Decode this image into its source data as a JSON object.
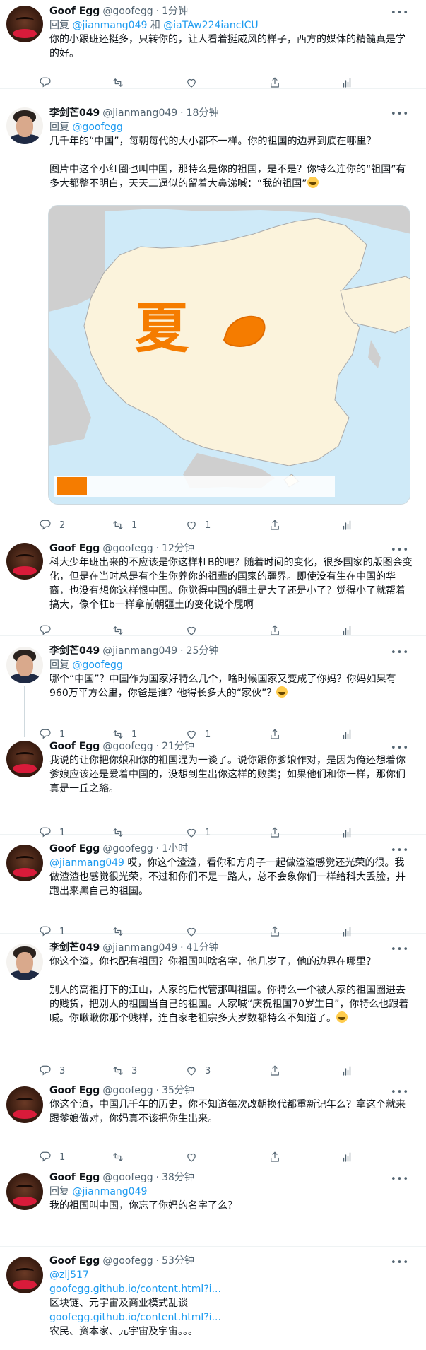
{
  "tweets": [
    {
      "name": "Goof Egg",
      "handle": "@goofegg",
      "time": "1分钟",
      "reply_prefix": "回复",
      "reply_to": "@jianmang049",
      "reply_joiner": "和",
      "reply_to_2": "@iaTAw224iancICU",
      "text": [
        "你的小跟班还挺多，只转你的，让人看着挺威风的样子，西方的媒体的精髓真是学的好。"
      ],
      "stats": {
        "reply": "",
        "retweet": "",
        "like": ""
      }
    },
    {
      "name": "李剑芒049",
      "handle": "@jianmang049",
      "time": "18分钟",
      "reply_prefix": "回复",
      "reply_to": "@goofegg",
      "text_1": "几千年的“中国”，每朝每代的大小都不一样。你的祖国的边界到底在哪里？",
      "text_2": "图片中这个小红圈也叫中国，那特么是你的祖国，是不是？你特么连你的“祖国”有多大都整不明白，天天二逼似的留着大鼻涕喊：“我的祖国”",
      "map_label": "夏",
      "stats": {
        "reply": "2",
        "retweet": "1",
        "like": "1"
      }
    },
    {
      "name": "Goof Egg",
      "handle": "@goofegg",
      "time": "12分钟",
      "text": [
        "科大少年班出来的不应该是你这样杠B的吧？随着时间的变化，很多国家的版图会变化，但是在当时总是有个生你养你的祖辈的国家的疆界。即使没有生在中国的华裔，也没有想你这样恨中国。你觉得中国的疆土是大了还是小了？觉得小了就帮着搞大，像个杠b一样拿前朝疆土的变化说个屁啊"
      ],
      "stats": {
        "reply": "",
        "retweet": "",
        "like": ""
      }
    },
    {
      "name": "李剑芒049",
      "handle": "@jianmang049",
      "time": "25分钟",
      "reply_prefix": "回复",
      "reply_to": "@goofegg",
      "text": [
        "哪个“中国”？中国作为国家好特么几个，啥时候国家又变成了你妈？你妈如果有960万平方公里，你爸是谁？他得长多大的“家伙”？"
      ],
      "stats": {
        "reply": "1",
        "retweet": "1",
        "like": "1"
      }
    },
    {
      "name": "Goof Egg",
      "handle": "@goofegg",
      "time": "21分钟",
      "text": [
        "我说的让你把你娘和你的祖国混为一谈了。说你跟你爹娘作对，是因为俺还想着你爹娘应该还是爱着中国的，没想到生出你这样的败类；如果他们和你一样，那你们真是一丘之貉。"
      ],
      "stats": {
        "reply": "1",
        "retweet": "",
        "like": "1"
      }
    },
    {
      "name": "Goof Egg",
      "handle": "@goofegg",
      "time": "1小时",
      "mention": "@jianmang049",
      "text_after_mention": "哎，你这个渣渣，看你和方舟子一起做渣渣感觉还光荣的很。我做渣渣也感觉很光荣，不过和你们不是一路人，总不会象你们一样给科大丢脸，并跑出来黑自己的祖国。",
      "stats": {
        "reply": "1",
        "retweet": "",
        "like": ""
      }
    },
    {
      "name": "李剑芒049",
      "handle": "@jianmang049",
      "time": "41分钟",
      "text_1": "你这个渣，你也配有祖国？你祖国叫啥名字，他几岁了，他的边界在哪里？",
      "text_2": "别人的高祖打下的江山，人家的后代管那叫祖国。你特么一个被人家的祖国圈进去的贱货，把别人的祖国当自己的祖国。人家喊“庆祝祖国70岁生日”，你特么也跟着喊。你瞅瞅你那个贱样，连自家老祖宗多大岁数都特么不知道了。",
      "stats": {
        "reply": "3",
        "retweet": "3",
        "like": "3"
      }
    },
    {
      "name": "Goof Egg",
      "handle": "@goofegg",
      "time": "35分钟",
      "text": [
        "你这个渣，中国几千年的历史，你不知道每次改朝换代都重新记年么？拿这个就来跟爹娘做对，你妈真不该把你生出来。"
      ],
      "stats": {
        "reply": "1",
        "retweet": "",
        "like": ""
      }
    },
    {
      "name": "Goof Egg",
      "handle": "@goofegg",
      "time": "38分钟",
      "reply_prefix": "回复",
      "reply_to": "@jianmang049",
      "text": [
        "我的祖国叫中国，你忘了你妈的名字了么？"
      ],
      "stats": {
        "reply": "",
        "retweet": "",
        "like": ""
      }
    },
    {
      "name": "Goof Egg",
      "handle": "@goofegg",
      "time": "53分钟",
      "mention": "@zlj517",
      "link_1": "goofegg.github.io/content.html?i...",
      "line_1": "区块链、元宇宙及商业模式乱谈",
      "link_2": "goofegg.github.io/content.html?i...",
      "line_2": "农民、资本家、元宇宙及宇宙。。。"
    }
  ],
  "icons": {
    "reply": "reply-icon",
    "retweet": "retweet-icon",
    "like": "like-icon",
    "share": "share-icon",
    "analytics": "analytics-icon",
    "more": "more-icon"
  },
  "colors": {
    "link": "#1d9bf0",
    "muted": "#536471",
    "map_orange": "#f57c00",
    "map_land": "#fbf3dc",
    "map_sea": "#cfeaf8",
    "map_neighbor": "#cfcfcf"
  }
}
